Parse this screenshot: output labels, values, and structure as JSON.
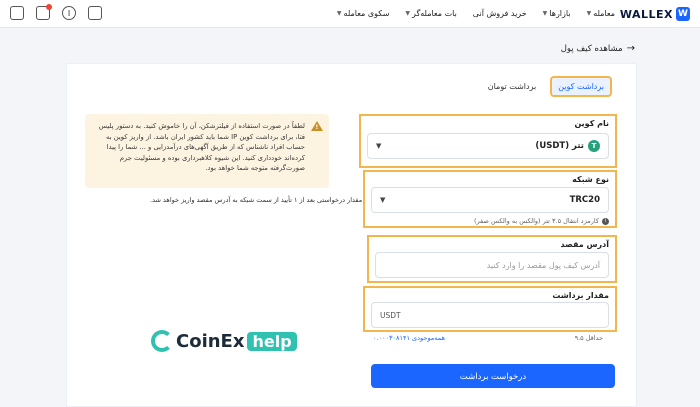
{
  "brand": {
    "name": "WALLEX"
  },
  "nav": {
    "items": [
      {
        "label": "معامله"
      },
      {
        "label": "بازارها"
      },
      {
        "label": "خرید فروش آنی"
      },
      {
        "label": "بات معامله‌گر"
      },
      {
        "label": "سکوی معامله"
      }
    ]
  },
  "back_link": "مشاهده کیف پول",
  "tabs": {
    "toman": "برداشت تومان",
    "coin": "برداشت کوین"
  },
  "coin_field": {
    "label": "نام کوین",
    "value": "تتر (USDT)"
  },
  "network_field": {
    "label": "نوع شبکه",
    "value": "TRC20",
    "note": "کارمزد انتقال ۳.۵ تتر (والکس به والکس صفر)"
  },
  "address_field": {
    "label": "آدرس مقصد",
    "placeholder": "آدرس کیف پول مقصد را وارد کنید"
  },
  "amount_field": {
    "label": "مقدار برداشت",
    "unit": "USDT",
    "balance": "همه‌موجودی ۰.۰۰۰۳۰۸۱۴۱",
    "minimum": "حداقل ۹.۵"
  },
  "submit_label": "درخواست برداشت",
  "warning": {
    "text": "لطفاً در صورت استفاده از فیلترشکن، آن را خاموش کنید. به دستور پلیس فتا، برای برداشت کوین IP شما باید کشور ایران باشد. از واریز کوین به حساب افراد ناشناس که از طریق آگهی‌های درآمدزایی و ... شما را پیدا کرده‌اند خودداری کنید. این شیوه کلاهبرداری بوده و مسئولیت جرم صورت‌گرفته متوجه شما خواهد بود."
  },
  "request_note": "مقدار درخواستی بعد از ۱ تأیید از سمت شبکه به آدرس مقصد واریز خواهد شد.",
  "watermark": {
    "brand": "CoinEx",
    "badge": "help"
  },
  "colors": {
    "primary": "#1a66ff",
    "highlight": "#f2b64c",
    "warning_bg": "#fdf3e1",
    "tether": "#26a17b"
  }
}
